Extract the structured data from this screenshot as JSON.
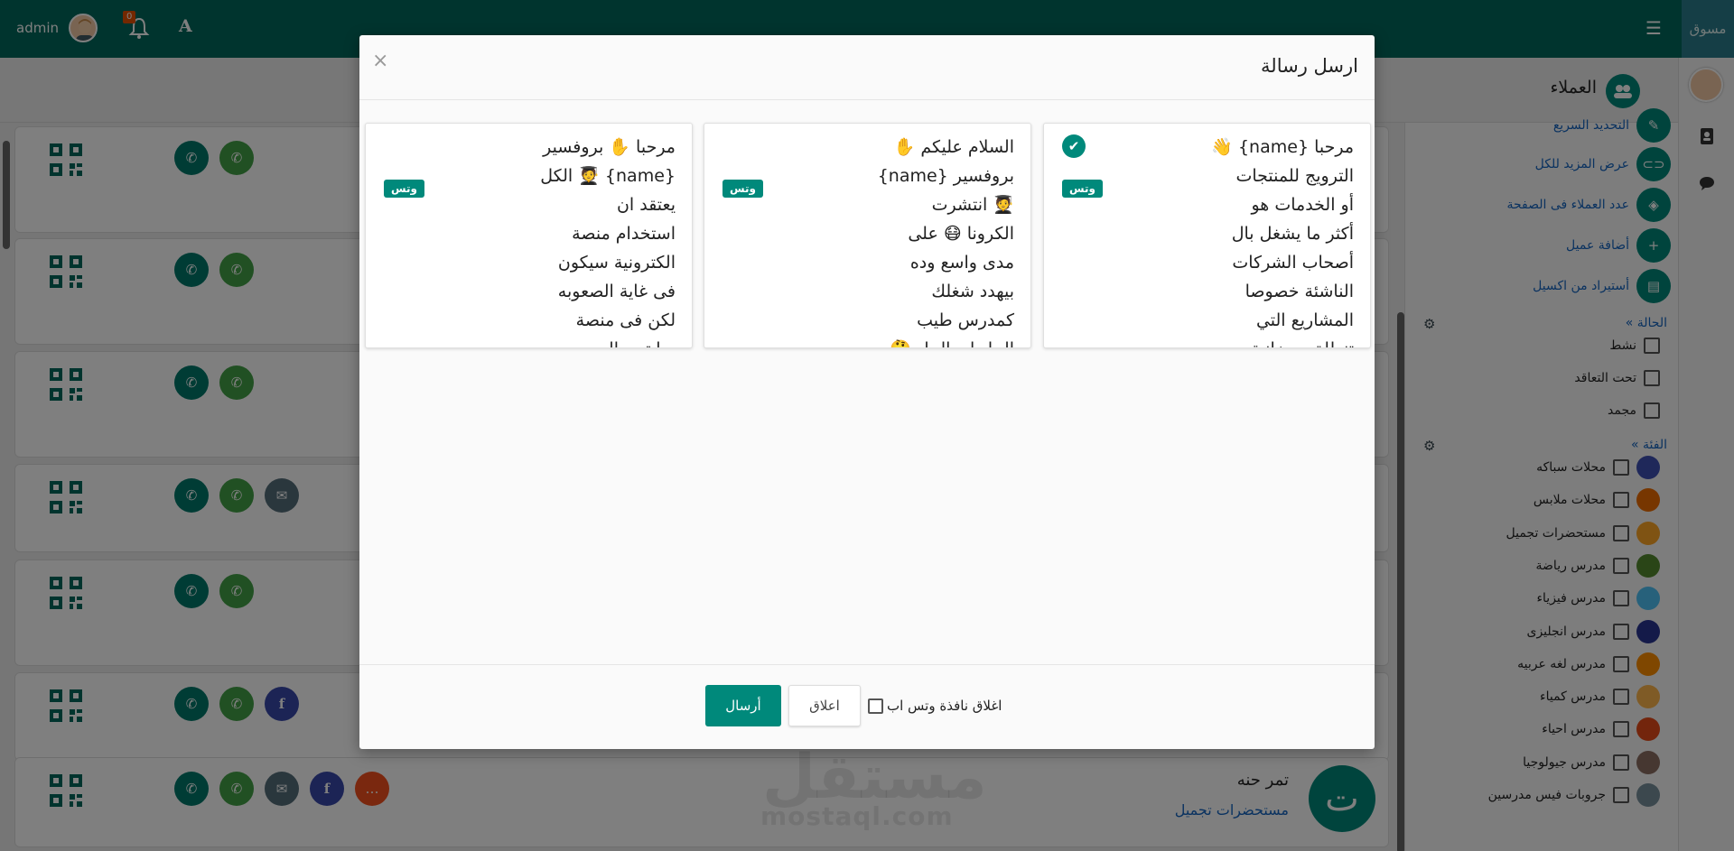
{
  "topbar": {
    "brand": "مسوق",
    "user": "admin",
    "notification_count": "0",
    "font_toggle": "A",
    "icons": [
      "menu-icon",
      "bell-icon",
      "font-size-icon"
    ]
  },
  "header": {
    "title": "العملاء"
  },
  "sidebar": {
    "actions": [
      {
        "label": "التحديد السريع",
        "icon": "pencil-icon"
      },
      {
        "label": "عرض المزيد للكل",
        "icon": "toggle-icon"
      },
      {
        "label": "عدد العملاء فى الصفحة",
        "icon": "tag-icon"
      },
      {
        "label": "أضافة عميل",
        "icon": "plus-icon"
      },
      {
        "label": "أستيراد من اكسيل",
        "icon": "excel-icon"
      }
    ],
    "status_title": "« الحالة",
    "status_options": [
      "نشط",
      "تحت التعاقد",
      "مجمد"
    ],
    "category_title": "« الفئة",
    "categories": [
      {
        "label": "محلات سباكه",
        "color": "#3f51b5"
      },
      {
        "label": "محلات ملابس",
        "color": "#ef6c00"
      },
      {
        "label": "مستحضرات تجميل",
        "color": "#ffa726"
      },
      {
        "label": "مدرس رياضة",
        "color": "#558b2f"
      },
      {
        "label": "مدرس فيزياء",
        "color": "#4fc3f7"
      },
      {
        "label": "مدرس انجليزى",
        "color": "#283593"
      },
      {
        "label": "مدرس لغه عربيه",
        "color": "#ff8f00"
      },
      {
        "label": "مدرس كمياء",
        "color": "#ffb74d"
      },
      {
        "label": "مدرس احياء",
        "color": "#e64a19"
      },
      {
        "label": "مدرس جيولوجيا",
        "color": "#8d6e63"
      },
      {
        "label": "جروبات فيس مدرسين",
        "color": "#78909c"
      }
    ]
  },
  "clients": [
    {
      "buttons": [
        "phone",
        "whatsapp"
      ]
    },
    {
      "buttons": [
        "phone",
        "whatsapp"
      ]
    },
    {
      "buttons": [
        "phone",
        "whatsapp"
      ]
    },
    {
      "buttons": [
        "phone",
        "whatsapp",
        "email"
      ]
    },
    {
      "buttons": [
        "phone",
        "whatsapp"
      ]
    },
    {
      "buttons": [
        "phone",
        "whatsapp",
        "facebook"
      ]
    },
    {
      "buttons": [
        "phone",
        "whatsapp",
        "email",
        "facebook",
        "chat"
      ],
      "name": "تمر حنه",
      "category": "مستحضرات تجميل",
      "initial": "ت"
    }
  ],
  "watermark": {
    "logo": "مستقل",
    "site": "mostaql.com"
  },
  "modal": {
    "title": "ارسل رسالة",
    "close_glyph": "×",
    "templates": [
      {
        "text": "مرحبا {name} 👋\nالترويج للمنتجات\nأو الخدمات هو\nأكثر ما يشغل بال\nأصحاب الشركات\nالناشئة خصوصا\nالمشاريع التي\nتنطلق بميزانية",
        "tag": "وتس",
        "selected": true
      },
      {
        "text": "السلام عليكم ✋\nبروفسير {name}\n🧑‍🎓 انتشرت\nالكرونا 😷 على\nمدى واسع وده\nبيهدد شغلك\nكمدرس طيب\nالحل ايه الحل 🤔",
        "tag": "وتس",
        "selected": false
      },
      {
        "text": "مرحبا ✋ بروفسير\n{name} 🧑‍🎓 الكل\nيعتقد ان\nاستخدام منصة\nالكترونية سيكون\nفى غاية الصعوبه\nلكن فى منصة\nسايتس الي",
        "tag": "وتس",
        "selected": false
      }
    ],
    "send_label": "أرسال",
    "close_label": "اعلاق",
    "close_wa_label": "اغلاق نافذة وتس اب"
  }
}
